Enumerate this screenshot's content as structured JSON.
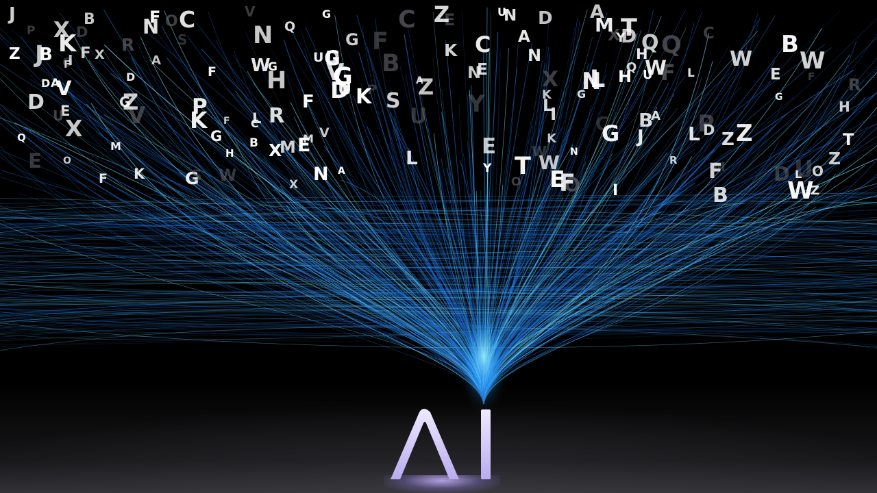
{
  "scene": {
    "background": "#000000",
    "strand_color": "#1e6fd9",
    "strand_highlight": "#6fe3ff",
    "letter_color_bright": "#ffffff",
    "letter_color_dim": "#6a6a72"
  },
  "logo": {
    "text": "AI",
    "color": "#d9d0f5"
  },
  "letters": [
    {
      "ch": "B",
      "b": 0
    },
    {
      "ch": "U",
      "b": 0
    },
    {
      "ch": "E",
      "b": 1
    },
    {
      "ch": "Q",
      "b": 0
    },
    {
      "ch": "M",
      "b": 0
    },
    {
      "ch": "D",
      "b": 0
    },
    {
      "ch": "V",
      "b": 1
    },
    {
      "ch": "R",
      "b": 0
    },
    {
      "ch": "O",
      "b": 0
    },
    {
      "ch": "N",
      "b": 1
    },
    {
      "ch": "E",
      "b": 0
    },
    {
      "ch": "V",
      "b": 0
    },
    {
      "ch": "U",
      "b": 0
    },
    {
      "ch": "C",
      "b": 0
    },
    {
      "ch": "C",
      "b": 0
    },
    {
      "ch": "W",
      "b": 0
    },
    {
      "ch": "D",
      "b": 1
    },
    {
      "ch": "L",
      "b": 1
    },
    {
      "ch": "N",
      "b": 1
    },
    {
      "ch": "X",
      "b": 0
    },
    {
      "ch": "F",
      "b": 0
    },
    {
      "ch": "P",
      "b": 0
    },
    {
      "ch": "Z",
      "b": 1
    },
    {
      "ch": "F",
      "b": 1
    },
    {
      "ch": "E",
      "b": 0
    },
    {
      "ch": "N",
      "b": 1
    },
    {
      "ch": "H",
      "b": 1
    },
    {
      "ch": "X",
      "b": 0
    },
    {
      "ch": "V",
      "b": 1
    },
    {
      "ch": "G",
      "b": 1
    },
    {
      "ch": "Z",
      "b": 1
    },
    {
      "ch": "K",
      "b": 1
    },
    {
      "ch": "H",
      "b": 1
    },
    {
      "ch": "R",
      "b": 0
    },
    {
      "ch": "G",
      "b": 1
    },
    {
      "ch": "F",
      "b": 0
    },
    {
      "ch": "X",
      "b": 1
    },
    {
      "ch": "G",
      "b": 1
    },
    {
      "ch": "O",
      "b": 0
    },
    {
      "ch": "D",
      "b": 0
    },
    {
      "ch": "G",
      "b": 1
    },
    {
      "ch": "K",
      "b": 1
    },
    {
      "ch": "J",
      "b": 1
    },
    {
      "ch": "F",
      "b": 0
    },
    {
      "ch": "U",
      "b": 1
    },
    {
      "ch": "Y",
      "b": 0
    },
    {
      "ch": "R",
      "b": 1
    },
    {
      "ch": "L",
      "b": 1
    },
    {
      "ch": "I",
      "b": 1
    },
    {
      "ch": "W",
      "b": 0
    },
    {
      "ch": "T",
      "b": 1
    },
    {
      "ch": "P",
      "b": 0
    },
    {
      "ch": "W",
      "b": 1
    },
    {
      "ch": "K",
      "b": 1
    },
    {
      "ch": "A",
      "b": 1
    },
    {
      "ch": "C",
      "b": 1
    },
    {
      "ch": "H",
      "b": 1
    },
    {
      "ch": "Q",
      "b": 1
    },
    {
      "ch": "W",
      "b": 1
    },
    {
      "ch": "D",
      "b": 1
    },
    {
      "ch": "O",
      "b": 1
    },
    {
      "ch": "Z",
      "b": 1
    },
    {
      "ch": "X",
      "b": 1
    },
    {
      "ch": "Z",
      "b": 1
    },
    {
      "ch": "F",
      "b": 1
    },
    {
      "ch": "B",
      "b": 1
    },
    {
      "ch": "R",
      "b": 1
    },
    {
      "ch": "D",
      "b": 1
    },
    {
      "ch": "U",
      "b": 0
    },
    {
      "ch": "E",
      "b": 1
    },
    {
      "ch": "G",
      "b": 1
    },
    {
      "ch": "K",
      "b": 1
    },
    {
      "ch": "X",
      "b": 1
    },
    {
      "ch": "F",
      "b": 1
    },
    {
      "ch": "E",
      "b": 1
    },
    {
      "ch": "L",
      "b": 1
    },
    {
      "ch": "M",
      "b": 1
    },
    {
      "ch": "B",
      "b": 1
    },
    {
      "ch": "Q",
      "b": 1
    },
    {
      "ch": "C",
      "b": 0
    },
    {
      "ch": "Y",
      "b": 1
    },
    {
      "ch": "I",
      "b": 1
    },
    {
      "ch": "D",
      "b": 1
    },
    {
      "ch": "X",
      "b": 1
    },
    {
      "ch": "N",
      "b": 1
    },
    {
      "ch": "H",
      "b": 1
    },
    {
      "ch": "B",
      "b": 1
    },
    {
      "ch": "Z",
      "b": 1
    },
    {
      "ch": "A",
      "b": 1
    },
    {
      "ch": "G",
      "b": 1
    },
    {
      "ch": "D",
      "b": 1
    },
    {
      "ch": "M",
      "b": 1
    },
    {
      "ch": "G",
      "b": 1
    },
    {
      "ch": "T",
      "b": 1
    },
    {
      "ch": "X",
      "b": 1
    },
    {
      "ch": "S",
      "b": 0
    },
    {
      "ch": "F",
      "b": 1
    },
    {
      "ch": "E",
      "b": 1
    },
    {
      "ch": "C",
      "b": 1
    },
    {
      "ch": "N",
      "b": 1
    },
    {
      "ch": "U",
      "b": 1
    },
    {
      "ch": "S",
      "b": 1
    },
    {
      "ch": "A",
      "b": 1
    },
    {
      "ch": "W",
      "b": 1
    },
    {
      "ch": "A",
      "b": 1
    },
    {
      "ch": "V",
      "b": 1
    },
    {
      "ch": "F",
      "b": 1
    },
    {
      "ch": "B",
      "b": 1
    },
    {
      "ch": "M",
      "b": 1
    },
    {
      "ch": "Q",
      "b": 1
    },
    {
      "ch": "P",
      "b": 0
    },
    {
      "ch": "E",
      "b": 1
    },
    {
      "ch": "D",
      "b": 1
    },
    {
      "ch": "N",
      "b": 1
    },
    {
      "ch": "F",
      "b": 1
    },
    {
      "ch": "W",
      "b": 1
    },
    {
      "ch": "J",
      "b": 1
    },
    {
      "ch": "Q",
      "b": 1
    },
    {
      "ch": "F",
      "b": 1
    },
    {
      "ch": "E",
      "b": 1
    },
    {
      "ch": "F",
      "b": 1
    },
    {
      "ch": "G",
      "b": 1
    },
    {
      "ch": "C",
      "b": 1
    },
    {
      "ch": "N",
      "b": 1
    },
    {
      "ch": "V",
      "b": 0
    },
    {
      "ch": "A",
      "b": 1
    },
    {
      "ch": "W",
      "b": 1
    },
    {
      "ch": "Z",
      "b": 1
    },
    {
      "ch": "N",
      "b": 1
    },
    {
      "ch": "J",
      "b": 1
    },
    {
      "ch": "A",
      "b": 1
    },
    {
      "ch": "G",
      "b": 1
    },
    {
      "ch": "L",
      "b": 1
    },
    {
      "ch": "Z",
      "b": 1
    },
    {
      "ch": "G",
      "b": 1
    },
    {
      "ch": "S",
      "b": 0
    },
    {
      "ch": "D",
      "b": 1
    },
    {
      "ch": "L",
      "b": 1
    },
    {
      "ch": "U",
      "b": 1
    },
    {
      "ch": "O",
      "b": 0
    },
    {
      "ch": "A",
      "b": 1
    },
    {
      "ch": "K",
      "b": 1
    },
    {
      "ch": "W",
      "b": 1
    },
    {
      "ch": "O",
      "b": 1
    },
    {
      "ch": "L",
      "b": 1
    },
    {
      "ch": "G",
      "b": 1
    },
    {
      "ch": "B",
      "b": 1
    },
    {
      "ch": "K",
      "b": 1
    },
    {
      "ch": "M",
      "b": 1
    },
    {
      "ch": "D",
      "b": 1
    },
    {
      "ch": "L",
      "b": 1
    },
    {
      "ch": "Z",
      "b": 1
    },
    {
      "ch": "P",
      "b": 1
    },
    {
      "ch": "T",
      "b": 1
    },
    {
      "ch": "H",
      "b": 1
    },
    {
      "ch": "F",
      "b": 1
    },
    {
      "ch": "I",
      "b": 1
    },
    {
      "ch": "K",
      "b": 1
    },
    {
      "ch": "O",
      "b": 0
    },
    {
      "ch": "Y",
      "b": 1
    },
    {
      "ch": "B",
      "b": 1
    },
    {
      "ch": "U",
      "b": 1
    }
  ]
}
